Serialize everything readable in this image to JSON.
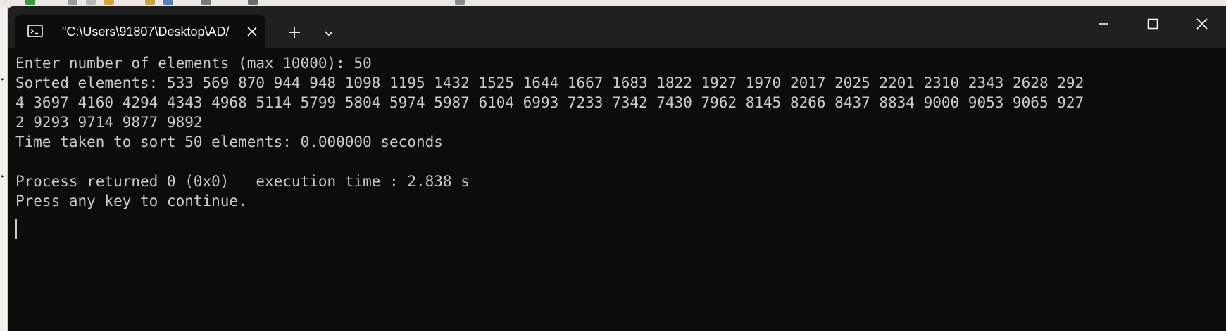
{
  "tab": {
    "title": "\"C:\\Users\\91807\\Desktop\\AD/"
  },
  "terminal": {
    "lines": [
      "Enter number of elements (max 10000): 50",
      "Sorted elements: 533 569 870 944 948 1098 1195 1432 1525 1644 1667 1683 1822 1927 1970 2017 2025 2201 2310 2343 2628 292",
      "4 3697 4160 4294 4343 4968 5114 5799 5804 5974 5987 6104 6993 7233 7342 7430 7962 8145 8266 8437 8834 9000 9053 9065 927",
      "2 9293 9714 9877 9892",
      "Time taken to sort 50 elements: 0.000000 seconds",
      "",
      "Process returned 0 (0x0)   execution time : 2.838 s",
      "Press any key to continue."
    ]
  },
  "colors": {
    "terminal_bg": "#0c0c0c",
    "titlebar_bg": "#202020",
    "text": "#cccccc"
  },
  "icons": {
    "tab": "terminal-icon",
    "close": "close-icon",
    "new_tab": "plus-icon",
    "dropdown": "chevron-down-icon",
    "minimize": "minimize-icon",
    "maximize": "maximize-icon",
    "window_close": "close-icon"
  }
}
